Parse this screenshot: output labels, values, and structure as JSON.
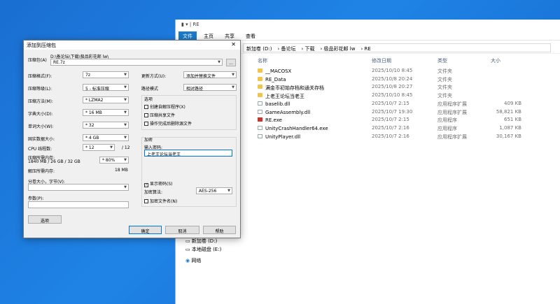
{
  "explorer": {
    "title": "RE",
    "ribbon_tabs": [
      "文件",
      "主页",
      "共享",
      "查看"
    ],
    "breadcrumb": [
      "新加卷 (D:)",
      "备论坛",
      "下载",
      "极品彩花邮 lw",
      "RE"
    ],
    "columns": {
      "name": "名称",
      "date": "修改日期",
      "type": "类型",
      "size": "大小"
    },
    "files": [
      {
        "name": "__MACOSX",
        "date": "2025/10/10 8:45",
        "type": "文件夹",
        "size": "",
        "icon": "folder"
      },
      {
        "name": "RE_Data",
        "date": "2025/10/8 20:24",
        "type": "文件夹",
        "size": "",
        "icon": "folder"
      },
      {
        "name": "满金币初始存档和通关存档",
        "date": "2025/10/8 20:27",
        "type": "文件夹",
        "size": "",
        "icon": "folder"
      },
      {
        "name": "上老王论坛当老王",
        "date": "2025/10/10 8:45",
        "type": "文件夹",
        "size": "",
        "icon": "folder"
      },
      {
        "name": "baselib.dll",
        "date": "2025/10/7 2:15",
        "type": "应用程序扩展",
        "size": "409 KB",
        "icon": "file"
      },
      {
        "name": "GameAssembly.dll",
        "date": "2025/10/7 19:30",
        "type": "应用程序扩展",
        "size": "58,821 KB",
        "icon": "file"
      },
      {
        "name": "RE.exe",
        "date": "2025/10/7 2:15",
        "type": "应用程序",
        "size": "651 KB",
        "icon": "exe"
      },
      {
        "name": "UnityCrashHandler64.exe",
        "date": "2025/10/7 2:16",
        "type": "应用程序",
        "size": "1,087 KB",
        "icon": "file"
      },
      {
        "name": "UnityPlayer.dll",
        "date": "2025/10/7 2:16",
        "type": "应用程序扩展",
        "size": "30,167 KB",
        "icon": "file"
      }
    ],
    "nav": [
      "新加卷 (D:)",
      "本地磁盘 (E:)",
      "网络"
    ]
  },
  "dialog": {
    "title": "添加到压缩包",
    "archive_label": "压缩包(A)",
    "archive_path": "D:\\备论坛\\下载\\极品彩花邮 lw\\",
    "archive_name": "RE.7z",
    "browse": "...",
    "format_label": "压缩格式(F):",
    "format_value": "7z",
    "level_label": "压缩等级(L):",
    "level_value": "5 - 标准压缩",
    "method_label": "压缩方法(M):",
    "method_value": "* LZMA2",
    "dict_label": "字典大小(D):",
    "dict_value": "* 16 MB",
    "word_label": "单词大小(W):",
    "word_value": "* 32",
    "solid_label": "固实数据大小:",
    "solid_value": "* 4 GB",
    "cpu_label": "CPU 线程数:",
    "cpu_value": "* 12",
    "cpu_total": "/ 12",
    "mem_label": "压缩所需内存:",
    "mem_info": "1840 MB / 26 GB / 32 GB",
    "mem_value": "* 80%",
    "decomp_label": "解压所需内存:",
    "decomp_value": "18 MB",
    "split_label": "分卷大小，字节(V):",
    "params_label": "参数(P):",
    "options_button": "选项",
    "update_label": "更新方式(U):",
    "update_value": "添加并替换文件",
    "pathmode_label": "路径模式",
    "pathmode_value": "相对路径",
    "options_group": "选项",
    "opt_sfx": "创建自解压程序(X)",
    "opt_shared": "压缩共享文件",
    "opt_delete": "操作完成后删除源文件",
    "encrypt_group": "加密",
    "password_label": "输入密码:",
    "password_value": "上老王论坛当老王",
    "show_password": "显示密码(S)",
    "enc_method_label": "加密算法:",
    "enc_method_value": "AES-256",
    "encrypt_names": "加密文件名(N)",
    "ok": "确定",
    "cancel": "取消",
    "help": "帮助"
  },
  "colors": {
    "desktop": "#1a6fd1",
    "ribbon_active": "#1979ca",
    "folder": "#f3c44a"
  }
}
